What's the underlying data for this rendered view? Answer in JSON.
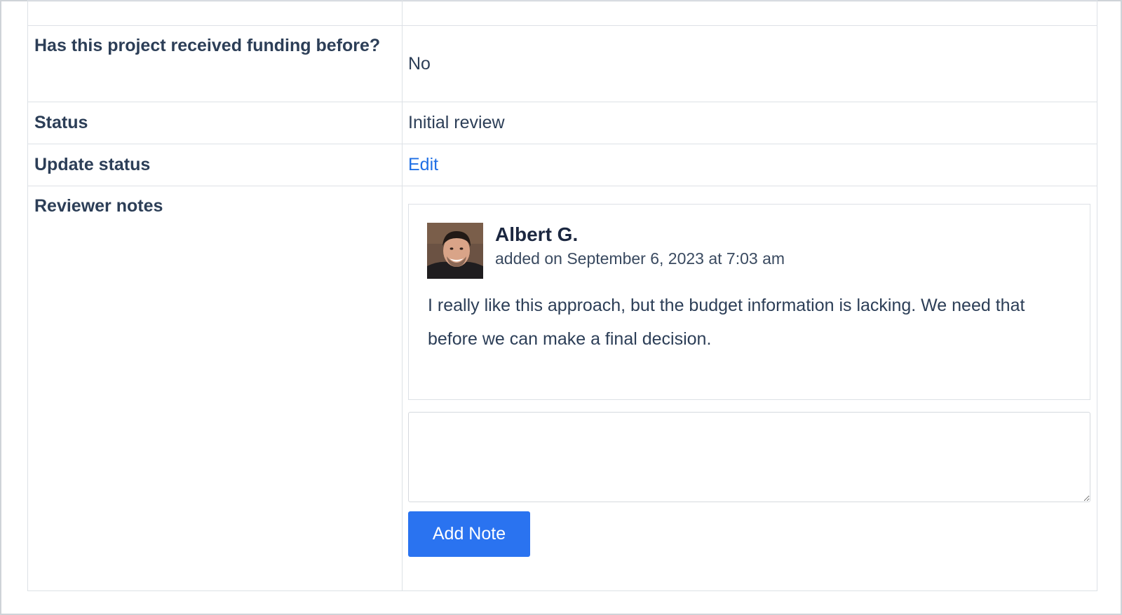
{
  "rows": {
    "funding": {
      "label": "Has this project received funding before?",
      "value": "No"
    },
    "status": {
      "label": "Status",
      "value": "Initial review"
    },
    "update_status": {
      "label": "Update status",
      "link": "Edit"
    },
    "reviewer_notes": {
      "label": "Reviewer notes"
    }
  },
  "note": {
    "author": "Albert G.",
    "meta": "added on September 6, 2023 at 7:03 am",
    "body": "I really like this approach, but the budget information is lacking. We need that before we can make a final decision."
  },
  "note_input": {
    "value": ""
  },
  "add_note_button": {
    "label": "Add Note"
  },
  "colors": {
    "text": "#2c3e57",
    "link": "#1f6fe5",
    "button": "#2a73f0",
    "border": "#dde1e6"
  }
}
